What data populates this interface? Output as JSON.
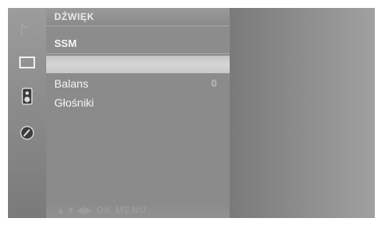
{
  "menu": {
    "title": "DŹWIĘK",
    "items": [
      {
        "label": "SSM",
        "value": ""
      },
      {
        "label": "",
        "value": ""
      },
      {
        "label": "Balans",
        "value": "0"
      },
      {
        "label": "Głośniki",
        "value": ""
      }
    ],
    "selected_index": 1
  },
  "footer": {
    "hint": "▲▼◀▶ OK MENU"
  },
  "sidebar": {
    "icons": [
      "picture-icon",
      "screen-icon",
      "speaker-icon",
      "clock-icon"
    ],
    "active": "speaker-icon"
  }
}
